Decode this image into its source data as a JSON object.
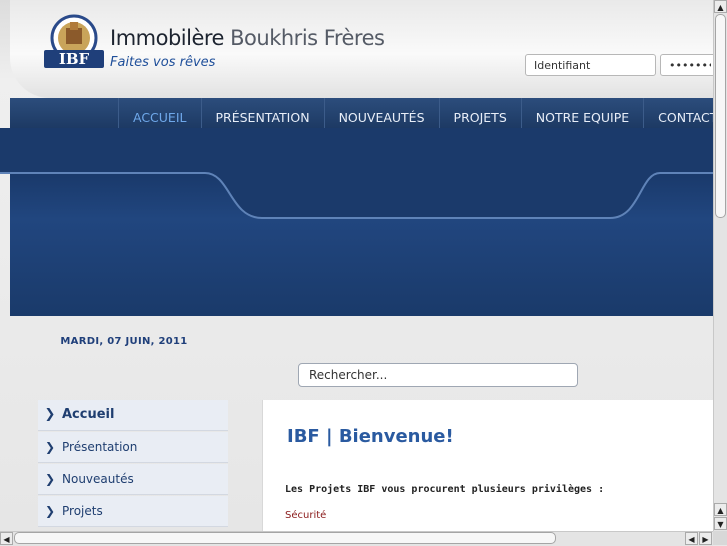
{
  "header": {
    "brand_strong": "Immobilère",
    "brand_light": " Boukhris Frères",
    "tagline": "Faites vos rêves",
    "login": {
      "user_value": "Identifiant",
      "pass_value": "••••••••"
    }
  },
  "nav": {
    "items": [
      {
        "label": "ACCUEIL"
      },
      {
        "label": "PRÉSENTATION"
      },
      {
        "label": "NOUVEAUTÉS"
      },
      {
        "label": "PROJETS"
      },
      {
        "label": "NOTRE EQUIPE"
      },
      {
        "label": "CONTACT"
      }
    ]
  },
  "date_text": "MARDI, 07 JUIN, 2011",
  "search": {
    "value": "Rechercher..."
  },
  "sidebar": {
    "items": [
      {
        "label": "Accueil"
      },
      {
        "label": "Présentation"
      },
      {
        "label": "Nouveautés"
      },
      {
        "label": "Projets"
      }
    ]
  },
  "content": {
    "title": "IBF | Bienvenue!",
    "lead": "Les Projets IBF vous procurent plusieurs privilèges :",
    "item1": "Sécurité"
  },
  "colors": {
    "nav": "#17325a",
    "accent": "#2a5aa0",
    "active_nav": "#6fa8ea"
  },
  "icons": [
    "logo-emblem",
    "chevron-right-icon",
    "scroll-up-icon",
    "scroll-down-icon",
    "scroll-left-icon",
    "scroll-right-icon"
  ]
}
